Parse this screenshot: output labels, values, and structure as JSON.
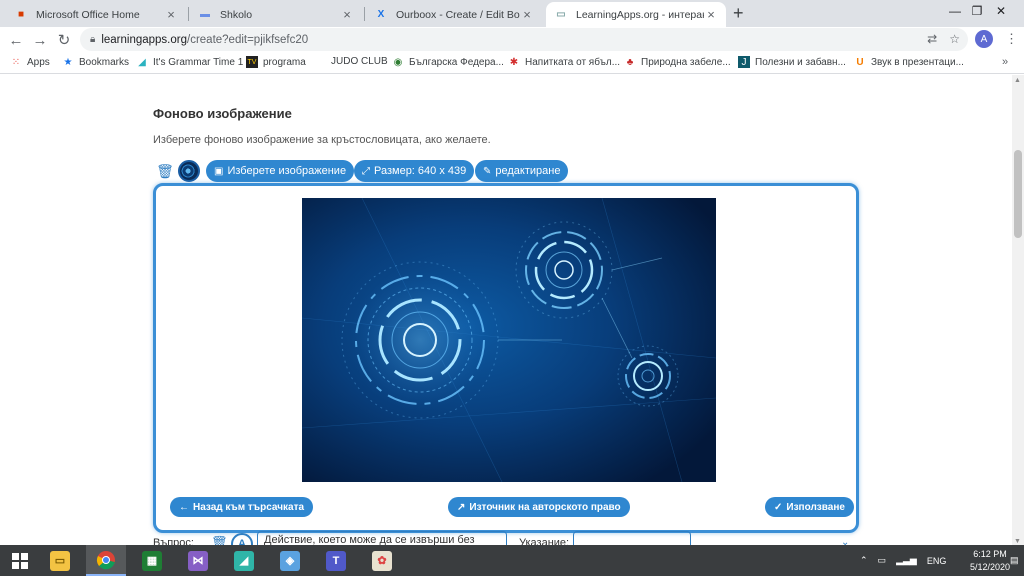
{
  "browser": {
    "tabs": [
      {
        "title": "Microsoft Office Home",
        "icon": "office-icon",
        "active": false
      },
      {
        "title": "Shkolo",
        "icon": "shkolo-icon",
        "active": false
      },
      {
        "title": "Ourboox - Create / Edit Book",
        "icon": "ourboox-icon",
        "active": false
      },
      {
        "title": "LearningApps.org - интерактиви",
        "icon": "learningapps-icon",
        "active": true
      }
    ],
    "new_tab": "+",
    "url_host": "learningapps.org",
    "url_path": "/create?edit=pjikfsefc20",
    "avatar_letter": "A",
    "bookmarks": [
      {
        "label": "Apps",
        "icon": "apps-grid-icon"
      },
      {
        "label": "Bookmarks",
        "icon": "star-icon"
      },
      {
        "label": "It's Grammar Time 1",
        "icon": "paper-plane-icon"
      },
      {
        "label": "programa",
        "icon": "tv-icon"
      },
      {
        "label": "JUDO CLUB",
        "icon": ""
      },
      {
        "label": "Българска Федера...",
        "icon": "federation-icon"
      },
      {
        "label": "Напитката от ябъл...",
        "icon": "apple-icon"
      },
      {
        "label": "Природна забеле...",
        "icon": "nature-icon"
      },
      {
        "label": "Полезни и забавн...",
        "icon": "j-icon"
      },
      {
        "label": "Звук в презентаци...",
        "icon": "sound-icon"
      }
    ]
  },
  "page": {
    "section_title": "Фоново изображение",
    "section_desc": "Изберете фоново изображение за кръстословицата, ако желаете.",
    "toolbar": {
      "choose_image": "Изберете изображение",
      "size": "Размер: 640 x 439",
      "edit": "редактиране"
    },
    "dialog": {
      "back_button": "Назад към търсачката",
      "source_button": "Източник на авторското право",
      "use_button": "Използване"
    },
    "below": {
      "question_label": "Въпрос:",
      "question_letter": "A",
      "question_text": "Действие, което може да се извърши без",
      "hint_label": "Указание:"
    }
  },
  "taskbar": {
    "lang": "ENG",
    "time": "6:12 PM",
    "date": "5/12/2020"
  },
  "colors": {
    "accent": "#2f87d0",
    "dialog_border": "#3b8fd6",
    "image_bg": "#062a55"
  }
}
